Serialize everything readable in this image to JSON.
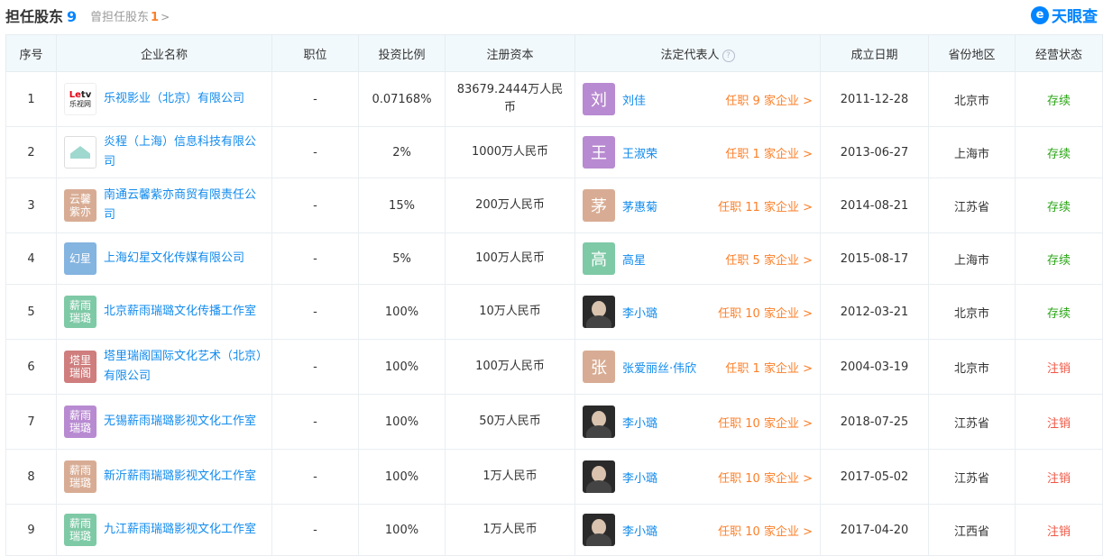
{
  "header": {
    "title": "担任股东",
    "count": "9",
    "former_label": "曾担任股东",
    "former_count": "1",
    "brand": "天眼查",
    "brand_icon": "tianyancha-logo-icon"
  },
  "columns": [
    "序号",
    "企业名称",
    "职位",
    "投资比例",
    "注册资本",
    "法定代表人",
    "成立日期",
    "省份地区",
    "经营状态"
  ],
  "colors": {
    "link": "#128bed",
    "orange": "#fc7f28",
    "active": "#2aa515",
    "cancelled": "#ef5644",
    "header_bg": "#f2f9fc"
  },
  "rows": [
    {
      "index": "1",
      "company": "乐视影业（北京）有限公司",
      "logo_type": "letv",
      "logo_text": "",
      "logo_color": "#ffffff",
      "position": "-",
      "ratio": "0.07168%",
      "capital": "83679.2444万人民币",
      "rep_char": "刘",
      "rep_color": "#b88ad1",
      "rep_photo": false,
      "rep_name": "刘佳",
      "rep_jobs": "任职 9 家企业",
      "founded": "2011-12-28",
      "region": "北京市",
      "status": "存续",
      "status_type": "active"
    },
    {
      "index": "2",
      "company": "炎程（上海）信息科技有限公司",
      "logo_type": "img",
      "logo_text": "",
      "logo_color": "#ffffff",
      "position": "-",
      "ratio": "2%",
      "capital": "1000万人民币",
      "rep_char": "王",
      "rep_color": "#b88ad1",
      "rep_photo": false,
      "rep_name": "王淑荣",
      "rep_jobs": "任职 1 家企业",
      "founded": "2013-06-27",
      "region": "上海市",
      "status": "存续",
      "status_type": "active"
    },
    {
      "index": "3",
      "company": "南通云馨紫亦商贸有限责任公司",
      "logo_type": "text",
      "logo_text": "云馨\n紫亦",
      "logo_color": "#d8ac94",
      "position": "-",
      "ratio": "15%",
      "capital": "200万人民币",
      "rep_char": "茅",
      "rep_color": "#d8ac94",
      "rep_photo": false,
      "rep_name": "茅惠菊",
      "rep_jobs": "任职 11 家企业",
      "founded": "2014-08-21",
      "region": "江苏省",
      "status": "存续",
      "status_type": "active"
    },
    {
      "index": "4",
      "company": "上海幻星文化传媒有限公司",
      "logo_type": "text",
      "logo_text": "幻星",
      "logo_color": "#84b4e0",
      "position": "-",
      "ratio": "5%",
      "capital": "100万人民币",
      "rep_char": "高",
      "rep_color": "#7ec9a6",
      "rep_photo": false,
      "rep_name": "高星",
      "rep_jobs": "任职 5 家企业",
      "founded": "2015-08-17",
      "region": "上海市",
      "status": "存续",
      "status_type": "active"
    },
    {
      "index": "5",
      "company": "北京薪雨瑞璐文化传播工作室",
      "logo_type": "text",
      "logo_text": "薪雨\n瑞璐",
      "logo_color": "#7ec9a6",
      "position": "-",
      "ratio": "100%",
      "capital": "10万人民币",
      "rep_char": "",
      "rep_color": "#2a2a2a",
      "rep_photo": true,
      "rep_name": "李小璐",
      "rep_jobs": "任职 10 家企业",
      "founded": "2012-03-21",
      "region": "北京市",
      "status": "存续",
      "status_type": "active"
    },
    {
      "index": "6",
      "company": "塔里瑞阁国际文化艺术（北京）有限公司",
      "logo_type": "text",
      "logo_text": "塔里\n瑞阁",
      "logo_color": "#cf7d7d",
      "position": "-",
      "ratio": "100%",
      "capital": "100万人民币",
      "rep_char": "张",
      "rep_color": "#d8ac94",
      "rep_photo": false,
      "rep_name": "张爱丽丝·伟欣",
      "rep_jobs": "任职 1 家企业",
      "founded": "2004-03-19",
      "region": "北京市",
      "status": "注销",
      "status_type": "cancelled"
    },
    {
      "index": "7",
      "company": "无锡薪雨瑞璐影视文化工作室",
      "logo_type": "text",
      "logo_text": "薪雨\n瑞璐",
      "logo_color": "#b88ad1",
      "position": "-",
      "ratio": "100%",
      "capital": "50万人民币",
      "rep_char": "",
      "rep_color": "#2a2a2a",
      "rep_photo": true,
      "rep_name": "李小璐",
      "rep_jobs": "任职 10 家企业",
      "founded": "2018-07-25",
      "region": "江苏省",
      "status": "注销",
      "status_type": "cancelled"
    },
    {
      "index": "8",
      "company": "新沂薪雨瑞璐影视文化工作室",
      "logo_type": "text",
      "logo_text": "薪雨\n瑞璐",
      "logo_color": "#d8ac94",
      "position": "-",
      "ratio": "100%",
      "capital": "1万人民币",
      "rep_char": "",
      "rep_color": "#2a2a2a",
      "rep_photo": true,
      "rep_name": "李小璐",
      "rep_jobs": "任职 10 家企业",
      "founded": "2017-05-02",
      "region": "江苏省",
      "status": "注销",
      "status_type": "cancelled"
    },
    {
      "index": "9",
      "company": "九江薪雨瑞璐影视文化工作室",
      "logo_type": "text",
      "logo_text": "薪雨\n瑞璐",
      "logo_color": "#7ec9a6",
      "position": "-",
      "ratio": "100%",
      "capital": "1万人民币",
      "rep_char": "",
      "rep_color": "#2a2a2a",
      "rep_photo": true,
      "rep_name": "李小璐",
      "rep_jobs": "任职 10 家企业",
      "founded": "2017-04-20",
      "region": "江西省",
      "status": "注销",
      "status_type": "cancelled"
    }
  ]
}
